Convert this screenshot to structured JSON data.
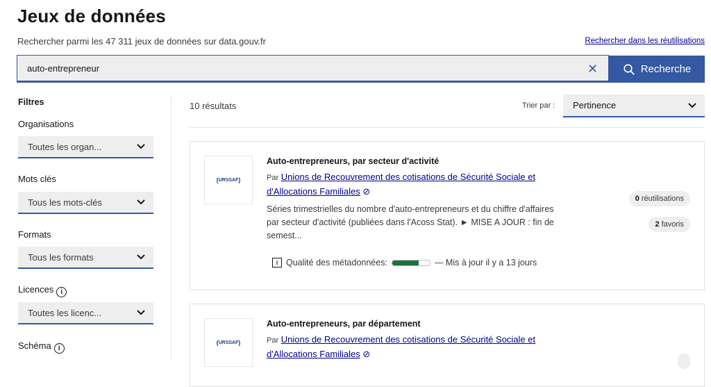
{
  "header": {
    "title": "Jeux de données",
    "subtitle": "Rechercher parmi les 47 311 jeux de données sur data.gouv.fr",
    "reuse_link": "Rechercher dans les réutilisations"
  },
  "search": {
    "value": "auto-entrepreneur",
    "clear_icon": "✕",
    "button_label": "Recherche",
    "button_icon": "search-icon"
  },
  "filters": {
    "title": "Filtres",
    "organisations": {
      "label": "Organisations",
      "value": "Toutes les organ..."
    },
    "keywords": {
      "label": "Mots clés",
      "value": "Tous les mots-clés"
    },
    "formats": {
      "label": "Formats",
      "value": "Tous les formats"
    },
    "licences": {
      "label": "Licences",
      "value": "Toutes les licenc..."
    },
    "schema": {
      "label": "Schéma"
    }
  },
  "results": {
    "count": "10 résultats",
    "sort_label": "Trier par :",
    "sort_value": "Pertinence",
    "items": [
      {
        "logo_text": "URSSAF",
        "title": "Auto-entrepreneurs, par secteur d'activité",
        "by": "Par",
        "org_line1": "Unions de Recouvrement des cotisations de Sécurité Sociale et",
        "org_line2": "d'Allocations Familiales",
        "verified_icon": "⊘",
        "desc_line1": "Séries trimestrielles du nombre d'auto-entrepreneurs et du chiffre d'affaires",
        "desc_line2": "par secteur d'activité (publiées dans l'Acoss Stat). ► MISE A JOUR : fin de",
        "desc_line3": "semest...",
        "quality_label": "Qualité des métadonnées:",
        "quality_level": 0.7,
        "updated": "— Mis à jour il y a 13 jours",
        "reuses_count": "0",
        "reuses_label": "réutilisations",
        "favorites_count": "2",
        "favorites_label": "favoris"
      },
      {
        "logo_text": "URSSAF",
        "title": "Auto-entrepreneurs, par département",
        "by": "Par",
        "org_line1": "Unions de Recouvrement des cotisations de Sécurité Sociale et",
        "org_line2": "d'Allocations Familiales",
        "verified_icon": "⊘"
      }
    ]
  },
  "colors": {
    "primary": "#3558a2",
    "link": "#000091",
    "quality": "#18753c"
  }
}
